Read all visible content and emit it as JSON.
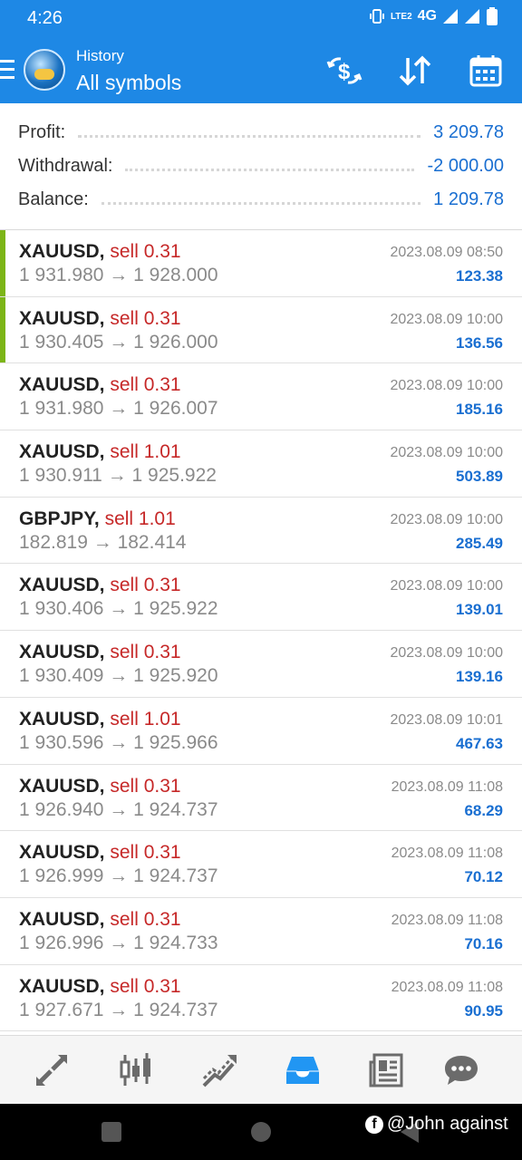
{
  "status_bar": {
    "time": "4:26",
    "network": "4G",
    "volte": "LTE2"
  },
  "header": {
    "subtitle": "History",
    "title": "All symbols"
  },
  "summary": [
    {
      "label": "Profit:",
      "value": "3 209.78"
    },
    {
      "label": "Withdrawal:",
      "value": "-2 000.00"
    },
    {
      "label": "Balance:",
      "value": "1 209.78"
    }
  ],
  "trades": [
    {
      "symbol": "XAUUSD,",
      "side": "sell 0.31",
      "prices": "1 931.980 → 1 928.000",
      "datetime": "2023.08.09 08:50",
      "profit": "123.38",
      "marker": true
    },
    {
      "symbol": "XAUUSD,",
      "side": "sell 0.31",
      "prices": "1 930.405 → 1 926.000",
      "datetime": "2023.08.09 10:00",
      "profit": "136.56",
      "marker": true
    },
    {
      "symbol": "XAUUSD,",
      "side": "sell 0.31",
      "prices": "1 931.980 → 1 926.007",
      "datetime": "2023.08.09 10:00",
      "profit": "185.16",
      "marker": false
    },
    {
      "symbol": "XAUUSD,",
      "side": "sell 1.01",
      "prices": "1 930.911 → 1 925.922",
      "datetime": "2023.08.09 10:00",
      "profit": "503.89",
      "marker": false
    },
    {
      "symbol": "GBPJPY,",
      "side": "sell 1.01",
      "prices": "182.819 → 182.414",
      "datetime": "2023.08.09 10:00",
      "profit": "285.49",
      "marker": false
    },
    {
      "symbol": "XAUUSD,",
      "side": "sell 0.31",
      "prices": "1 930.406 → 1 925.922",
      "datetime": "2023.08.09 10:00",
      "profit": "139.01",
      "marker": false
    },
    {
      "symbol": "XAUUSD,",
      "side": "sell 0.31",
      "prices": "1 930.409 → 1 925.920",
      "datetime": "2023.08.09 10:00",
      "profit": "139.16",
      "marker": false
    },
    {
      "symbol": "XAUUSD,",
      "side": "sell 1.01",
      "prices": "1 930.596 → 1 925.966",
      "datetime": "2023.08.09 10:01",
      "profit": "467.63",
      "marker": false
    },
    {
      "symbol": "XAUUSD,",
      "side": "sell 0.31",
      "prices": "1 926.940 → 1 924.737",
      "datetime": "2023.08.09 11:08",
      "profit": "68.29",
      "marker": false
    },
    {
      "symbol": "XAUUSD,",
      "side": "sell 0.31",
      "prices": "1 926.999 → 1 924.737",
      "datetime": "2023.08.09 11:08",
      "profit": "70.12",
      "marker": false
    },
    {
      "symbol": "XAUUSD,",
      "side": "sell 0.31",
      "prices": "1 926.996 → 1 924.733",
      "datetime": "2023.08.09 11:08",
      "profit": "70.16",
      "marker": false
    },
    {
      "symbol": "XAUUSD,",
      "side": "sell 0.31",
      "prices": "1 927.671 → 1 924.737",
      "datetime": "2023.08.09 11:08",
      "profit": "90.95",
      "marker": false
    }
  ],
  "bottom_nav": [
    {
      "name": "quotes-icon"
    },
    {
      "name": "chart-icon"
    },
    {
      "name": "trade-icon"
    },
    {
      "name": "history-icon",
      "active": true
    },
    {
      "name": "news-icon"
    },
    {
      "name": "messages-icon"
    }
  ],
  "watermark": "@John against",
  "colors": {
    "accent": "#1e88e5",
    "sell": "#c62828",
    "profit": "#1a6fd1",
    "marker": "#7cb517"
  }
}
